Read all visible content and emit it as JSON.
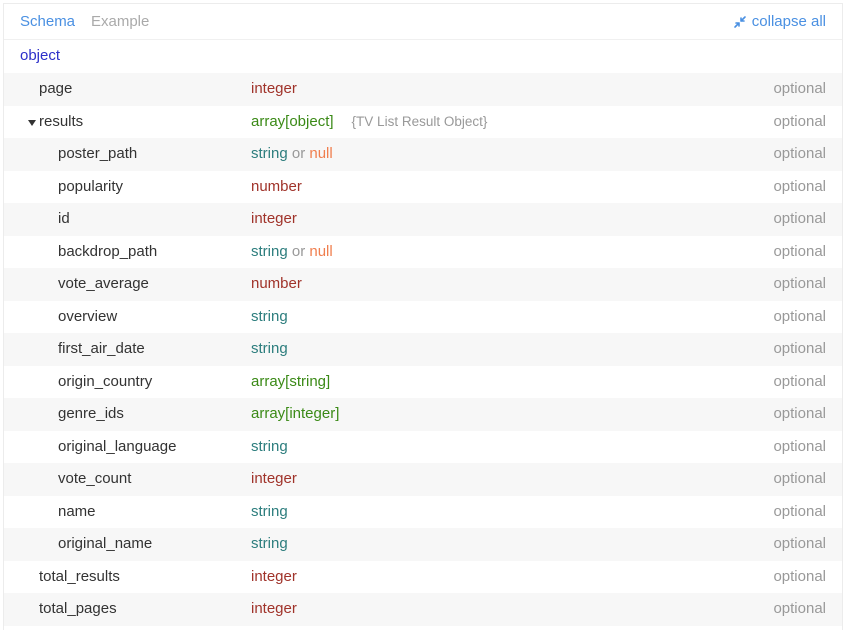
{
  "tabs": {
    "schema": "Schema",
    "example": "Example",
    "collapse_all": "collapse all"
  },
  "root": "object",
  "rows": [
    {
      "name": "page",
      "type": "integer",
      "optional": "optional"
    },
    {
      "name": "results",
      "type": "array[object]",
      "ref": "{TV List Result Object}",
      "optional": "optional",
      "expanded": true
    },
    {
      "name": "poster_path",
      "type": "string",
      "or": "or",
      "type2": "null",
      "optional": "optional"
    },
    {
      "name": "popularity",
      "type": "number",
      "optional": "optional"
    },
    {
      "name": "id",
      "type": "integer",
      "optional": "optional"
    },
    {
      "name": "backdrop_path",
      "type": "string",
      "or": "or",
      "type2": "null",
      "optional": "optional"
    },
    {
      "name": "vote_average",
      "type": "number",
      "optional": "optional"
    },
    {
      "name": "overview",
      "type": "string",
      "optional": "optional"
    },
    {
      "name": "first_air_date",
      "type": "string",
      "optional": "optional"
    },
    {
      "name": "origin_country",
      "type": "array[string]",
      "optional": "optional"
    },
    {
      "name": "genre_ids",
      "type": "array[integer]",
      "optional": "optional"
    },
    {
      "name": "original_language",
      "type": "string",
      "optional": "optional"
    },
    {
      "name": "vote_count",
      "type": "integer",
      "optional": "optional"
    },
    {
      "name": "name",
      "type": "string",
      "optional": "optional"
    },
    {
      "name": "original_name",
      "type": "string",
      "optional": "optional"
    },
    {
      "name": "total_results",
      "type": "integer",
      "optional": "optional"
    },
    {
      "name": "total_pages",
      "type": "integer",
      "optional": "optional"
    }
  ],
  "colors": {
    "accent": "#4a90e2",
    "root": "#2c2fc9",
    "integer": "#a0332a",
    "string": "#2c7d7d",
    "array": "#3b8a17",
    "null": "#f07f4f"
  },
  "icons": {
    "collapse": "collapse-arrows-icon",
    "toggle": "caret-down-icon"
  }
}
